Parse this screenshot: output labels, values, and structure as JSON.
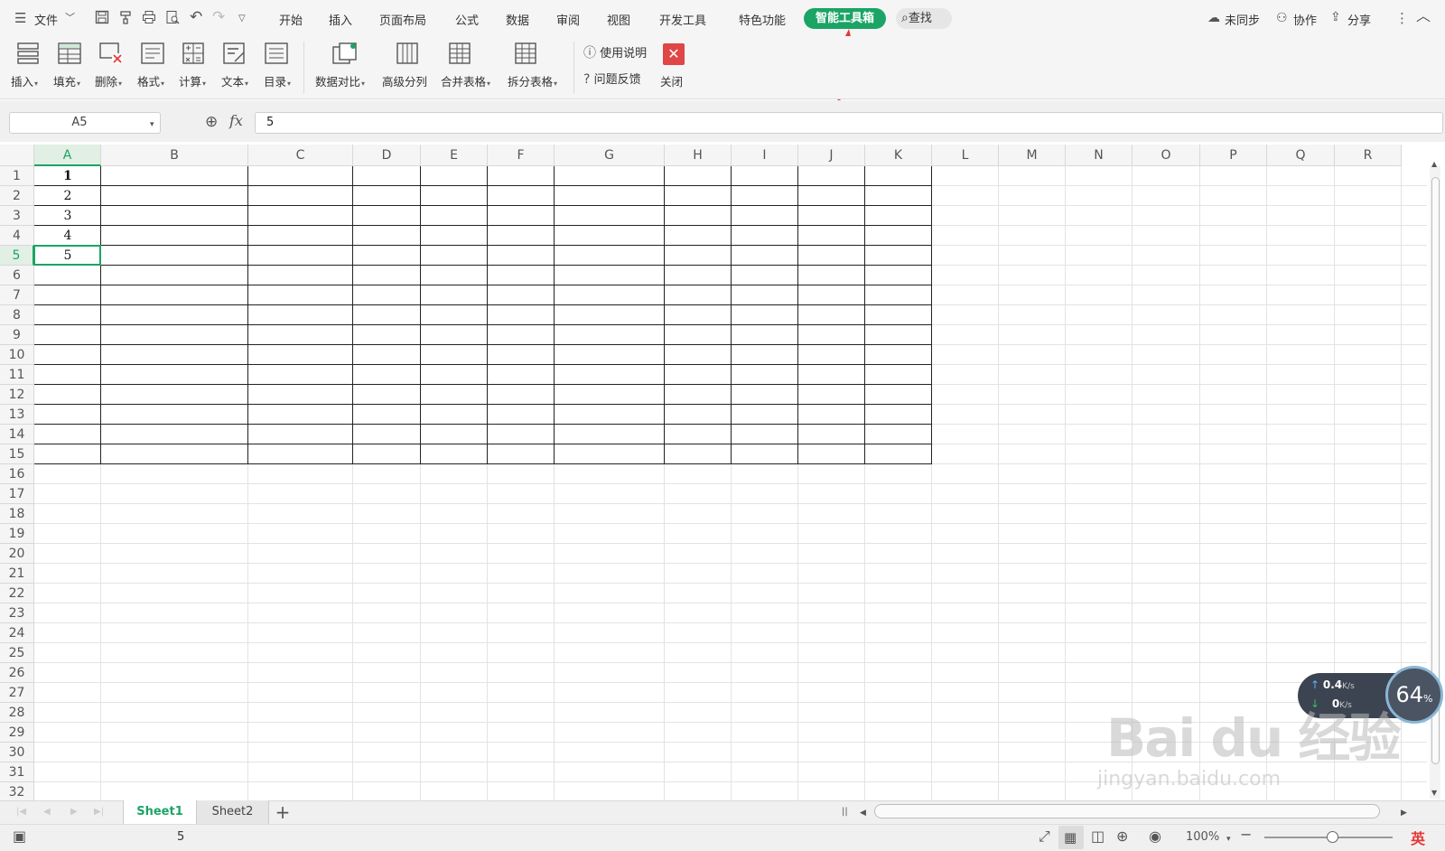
{
  "menu": {
    "file": "文件",
    "tabs": [
      "开始",
      "插入",
      "页面布局",
      "公式",
      "数据",
      "审阅",
      "视图",
      "开发工具",
      "特色功能"
    ],
    "active_tab": "智能工具箱",
    "search": "查找",
    "right": [
      "未同步",
      "协作",
      "分享"
    ]
  },
  "ribbon": {
    "buttons": [
      "插入",
      "填充",
      "删除",
      "格式",
      "计算",
      "文本",
      "目录",
      "数据对比",
      "高级分列",
      "合并表格",
      "拆分表格"
    ],
    "help": "使用说明",
    "feedback": "问题反馈",
    "close": "关闭"
  },
  "formula_bar": {
    "name_box": "A5",
    "fx": "fx",
    "value": "5"
  },
  "grid": {
    "columns": [
      "A",
      "B",
      "C",
      "D",
      "E",
      "F",
      "G",
      "H",
      "I",
      "J",
      "K",
      "L",
      "M",
      "N",
      "O",
      "P",
      "Q",
      "R"
    ],
    "rows": [
      "1",
      "2",
      "3",
      "4",
      "5",
      "6",
      "7",
      "8",
      "9",
      "10",
      "11",
      "12",
      "13",
      "14",
      "15",
      "16",
      "17",
      "18",
      "19",
      "20",
      "21",
      "22",
      "23",
      "24",
      "25",
      "26",
      "27",
      "28",
      "29",
      "30",
      "31",
      "32"
    ],
    "selected_column": "A",
    "selected_row": "5",
    "cells_A": [
      "1",
      "2",
      "3",
      "4",
      "5"
    ]
  },
  "sheets": {
    "tabs": [
      "Sheet1",
      "Sheet2"
    ],
    "active": "Sheet1",
    "add": "+"
  },
  "status": {
    "value": "5",
    "zoom": "100%",
    "ime": "英"
  },
  "net_widget": {
    "up": "0.4",
    "down": "0",
    "unit": "K/s",
    "percent": "64",
    "pct_sign": "%"
  },
  "watermark": {
    "logo": "Bai du 经验",
    "url": "jingyan.baidu.com"
  },
  "colors": {
    "accent": "#1ba466",
    "header_bg": "#f5f5f5",
    "arrow": "#e53935"
  }
}
